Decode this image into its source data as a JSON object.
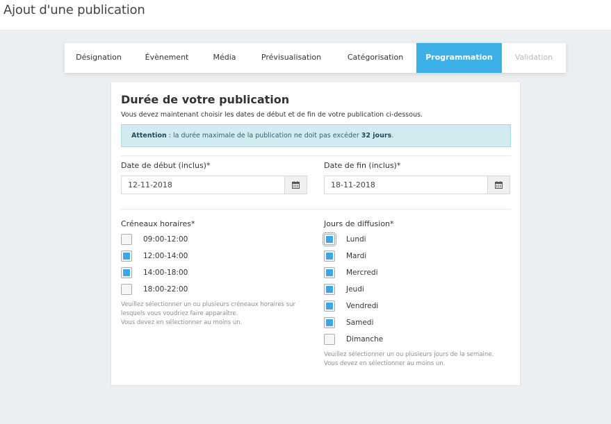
{
  "header": {
    "title": "Ajout d'une publication"
  },
  "tabs": [
    {
      "label": "Désignation"
    },
    {
      "label": "Évènement"
    },
    {
      "label": "Média"
    },
    {
      "label": "Prévisualisation"
    },
    {
      "label": "Catégorisation"
    },
    {
      "label": "Programmation"
    },
    {
      "label": "Validation"
    }
  ],
  "card": {
    "title": "Durée de votre publication",
    "intro": "Vous devez maintenant choisir les dates de début et de fin de votre publication ci-dessous.",
    "alert": {
      "strong": "Attention",
      "text": " : la durée maximale de la publication ne doit pas excéder ",
      "emphasis": "32 jours",
      "end": "."
    },
    "start_date": {
      "label": "Date de début (inclus)*",
      "value": "12-11-2018"
    },
    "end_date": {
      "label": "Date de fin (inclus)*",
      "value": "18-11-2018"
    },
    "slots": {
      "label": "Créneaux horaires*",
      "items": [
        {
          "label": "09:00-12:00",
          "checked": false
        },
        {
          "label": "12:00-14:00",
          "checked": true
        },
        {
          "label": "14:00-18:00",
          "checked": true
        },
        {
          "label": "18:00-22:00",
          "checked": false
        }
      ],
      "help": [
        "Veuillez sélectionner un ou plusieurs créneaux horaires sur",
        "lesquels vous voudriez faire apparaître.",
        "Vous devez en sélectionner au moins un."
      ]
    },
    "days": {
      "label": "Jours de diffusion*",
      "items": [
        {
          "label": "Lundi",
          "checked": true
        },
        {
          "label": "Mardi",
          "checked": true
        },
        {
          "label": "Mercredi",
          "checked": true
        },
        {
          "label": "Jeudi",
          "checked": true
        },
        {
          "label": "Vendredi",
          "checked": true
        },
        {
          "label": "Samedi",
          "checked": true
        },
        {
          "label": "Dimanche",
          "checked": false
        }
      ],
      "help": [
        "Veuillez sélectionner un ou plusieurs jours de la semaine.",
        "Vous devez en sélectionner au moins un."
      ]
    }
  },
  "colors": {
    "accent": "#3db0e7",
    "alert_bg": "#d2ebf1",
    "page_bg": "#eceff1"
  },
  "icons": {
    "date_picker": "calendar-icon"
  }
}
